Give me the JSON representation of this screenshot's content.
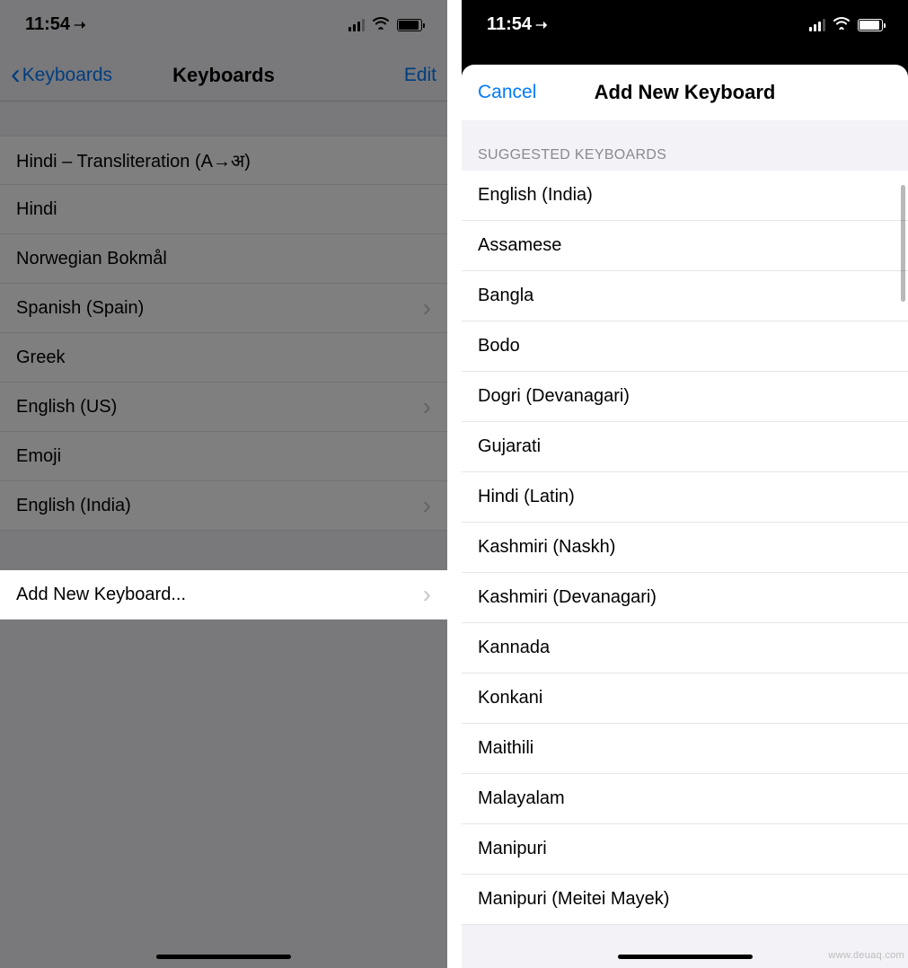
{
  "status": {
    "time": "11:54",
    "location_icon": "➤"
  },
  "left": {
    "back_label": "Keyboards",
    "title": "Keyboards",
    "edit_label": "Edit",
    "keyboards": [
      {
        "label": "Hindi – Transliteration (A→अ)",
        "has_chevron": false
      },
      {
        "label": "Hindi",
        "has_chevron": false
      },
      {
        "label": "Norwegian Bokmål",
        "has_chevron": false
      },
      {
        "label": "Spanish (Spain)",
        "has_chevron": true
      },
      {
        "label": "Greek",
        "has_chevron": false
      },
      {
        "label": "English (US)",
        "has_chevron": true
      },
      {
        "label": "Emoji",
        "has_chevron": false
      },
      {
        "label": "English (India)",
        "has_chevron": true
      }
    ],
    "add_new_label": "Add New Keyboard..."
  },
  "right": {
    "cancel_label": "Cancel",
    "sheet_title": "Add New Keyboard",
    "section_header": "SUGGESTED KEYBOARDS",
    "suggested": [
      "English (India)",
      "Assamese",
      "Bangla",
      "Bodo",
      "Dogri (Devanagari)",
      "Gujarati",
      "Hindi (Latin)",
      "Kashmiri (Naskh)",
      "Kashmiri (Devanagari)",
      "Kannada",
      "Konkani",
      "Maithili",
      "Malayalam",
      "Manipuri",
      "Manipuri (Meitei Mayek)"
    ]
  },
  "watermark": "www.deuaq.com"
}
